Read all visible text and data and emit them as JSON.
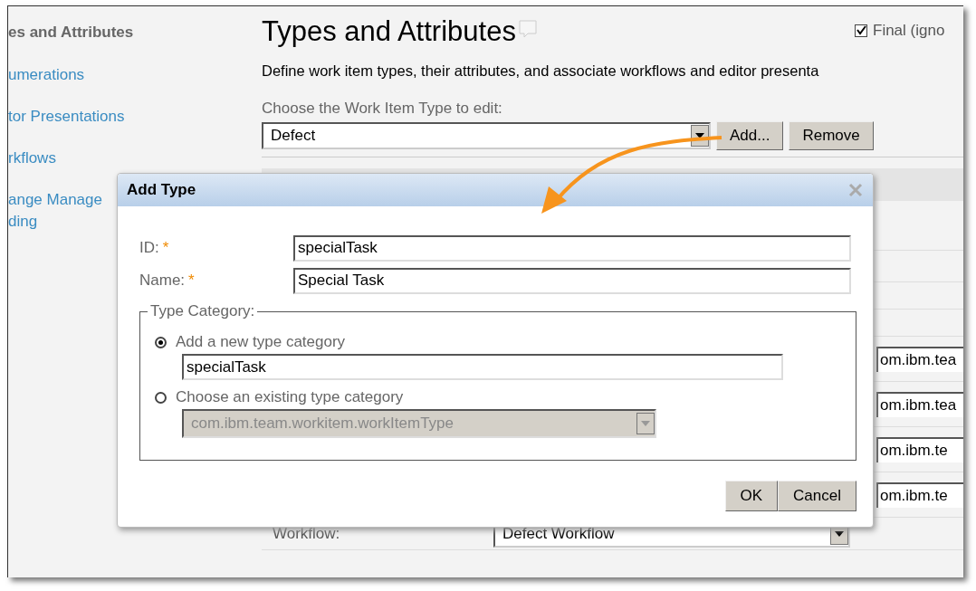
{
  "sidebar": {
    "heading": "es and Attributes",
    "items": [
      {
        "lines": [
          "umerations"
        ]
      },
      {
        "lines": [
          "tor Presentations"
        ]
      },
      {
        "lines": [
          "rkflows"
        ]
      },
      {
        "lines": [
          "ange Manage",
          "ding"
        ]
      }
    ]
  },
  "main": {
    "title": "Types and Attributes",
    "final_checkbox": {
      "label": "Final (igno",
      "checked": true
    },
    "description": "Define work item types, their attributes, and associate workflows and editor presenta",
    "type_label": "Choose the Work Item Type to edit:",
    "type_select": {
      "value": "Defect"
    },
    "buttons": [
      "Add...",
      "Remove"
    ],
    "attribute_rows": [
      {
        "value": "om.ibm.tea"
      },
      {
        "value": "om.ibm.tea"
      },
      {
        "value": "om.ibm.te"
      },
      {
        "value": "om.ibm.te"
      }
    ],
    "workflow": {
      "label": "Workflow:",
      "value": "Defect Workflow"
    }
  },
  "dialog": {
    "title": "Add Type",
    "fields": [
      {
        "label": "ID:",
        "required_mark": "*",
        "value": "specialTask"
      },
      {
        "label": "Name:",
        "required_mark": "*",
        "value": "Special Task"
      }
    ],
    "type_category": {
      "legend": "Type Category:",
      "options": [
        {
          "kind": "text",
          "label": "Add a new type category",
          "selected": true,
          "value": "specialTask",
          "disabled": false
        },
        {
          "kind": "select",
          "label": "Choose an existing type category",
          "selected": false,
          "value": "com.ibm.team.workitem.workItemType",
          "disabled": true
        }
      ]
    },
    "buttons": [
      "OK",
      "Cancel"
    ]
  }
}
